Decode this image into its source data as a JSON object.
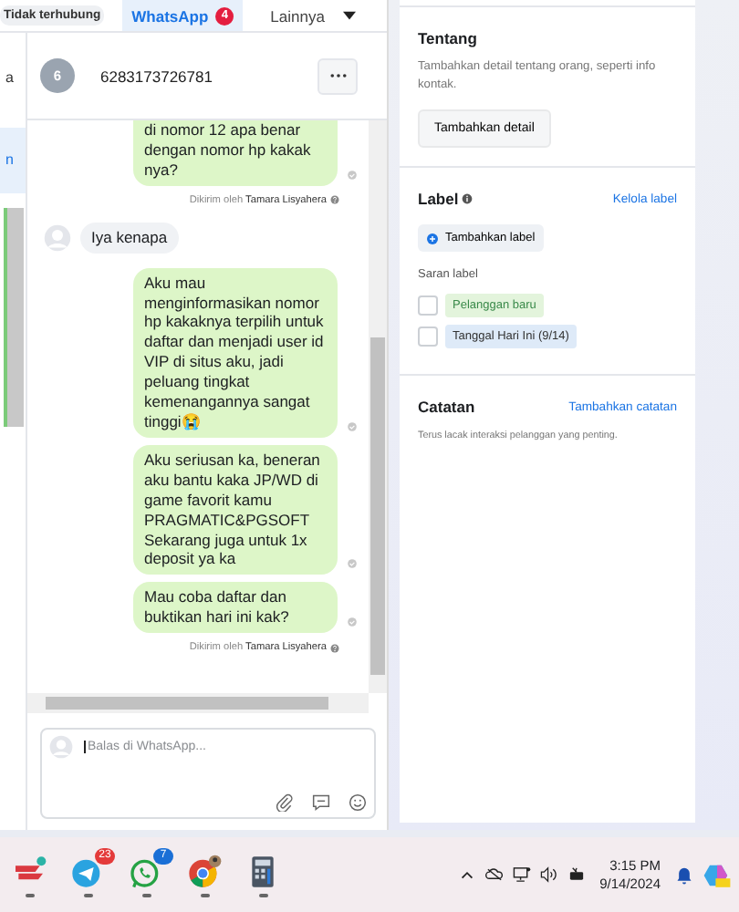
{
  "connection_status": "Tidak terhubung",
  "tabs": [
    {
      "label": "WhatsApp",
      "badge": "4",
      "has_menu": false,
      "selected": true
    },
    {
      "label": "Lainnya",
      "has_menu": true,
      "selected": false
    }
  ],
  "sidebar_fragments": [
    {
      "text": "a",
      "selected": false
    },
    {
      "text": "n",
      "selected": true
    }
  ],
  "chat": {
    "avatar_letter": "6",
    "name": "6283173726781",
    "messages": [
      {
        "kind": "out",
        "text": "di nomor 12 apa benar dengan nomor hp kakak nya?",
        "sent_by_prefix": "Dikirim oleh",
        "sent_by": "Tamara Lisyahera",
        "cut_top": true
      },
      {
        "kind": "in",
        "text": "Iya kenapa",
        "cut_top": false
      },
      {
        "kind": "out",
        "text": "Aku mau menginformasikan nomor hp kakaknya terpilih untuk daftar dan menjadi user id VIP di situs aku, jadi peluang tingkat kemenangannya sangat tinggi😭",
        "cut_top": false
      },
      {
        "kind": "out",
        "text": "Aku seriusan ka, beneran aku bantu kaka JP/WD di game favorit kamu PRAGMATIC&PGSOFT Sekarang juga untuk 1x deposit ya ka",
        "cut_top": false
      },
      {
        "kind": "out",
        "text": "Mau coba daftar dan buktikan hari ini kak?",
        "sent_by_prefix": "Dikirim oleh",
        "sent_by": "Tamara Lisyahera",
        "cut_top": false
      }
    ],
    "reply_placeholder": "Balas di WhatsApp..."
  },
  "about": {
    "title": "Tentang",
    "description": "Tambahkan detail tentang orang, seperti info kontak.",
    "button": "Tambahkan detail"
  },
  "labels": {
    "title": "Label",
    "manage_link": "Kelola label",
    "add_button": "Tambahkan label",
    "suggestions_title": "Saran label",
    "suggestions": [
      {
        "text": "Pelanggan baru",
        "checked": false,
        "color": "#e3f4dc"
      },
      {
        "text": "Tanggal Hari Ini (9/14)",
        "checked": false,
        "color": "#deeaf8"
      }
    ]
  },
  "notes": {
    "title": "Catatan",
    "add_link": "Tambahkan catatan",
    "description": "Terus lacak interaksi pelanggan yang penting."
  },
  "taskbar": {
    "apps": [
      {
        "kind": "vpn"
      },
      {
        "kind": "telegram",
        "badge": "23"
      },
      {
        "kind": "whatsapp",
        "badge": "7"
      },
      {
        "kind": "chrome"
      },
      {
        "kind": "calculator"
      }
    ],
    "time": "3:15 PM",
    "date": "9/14/2024"
  }
}
